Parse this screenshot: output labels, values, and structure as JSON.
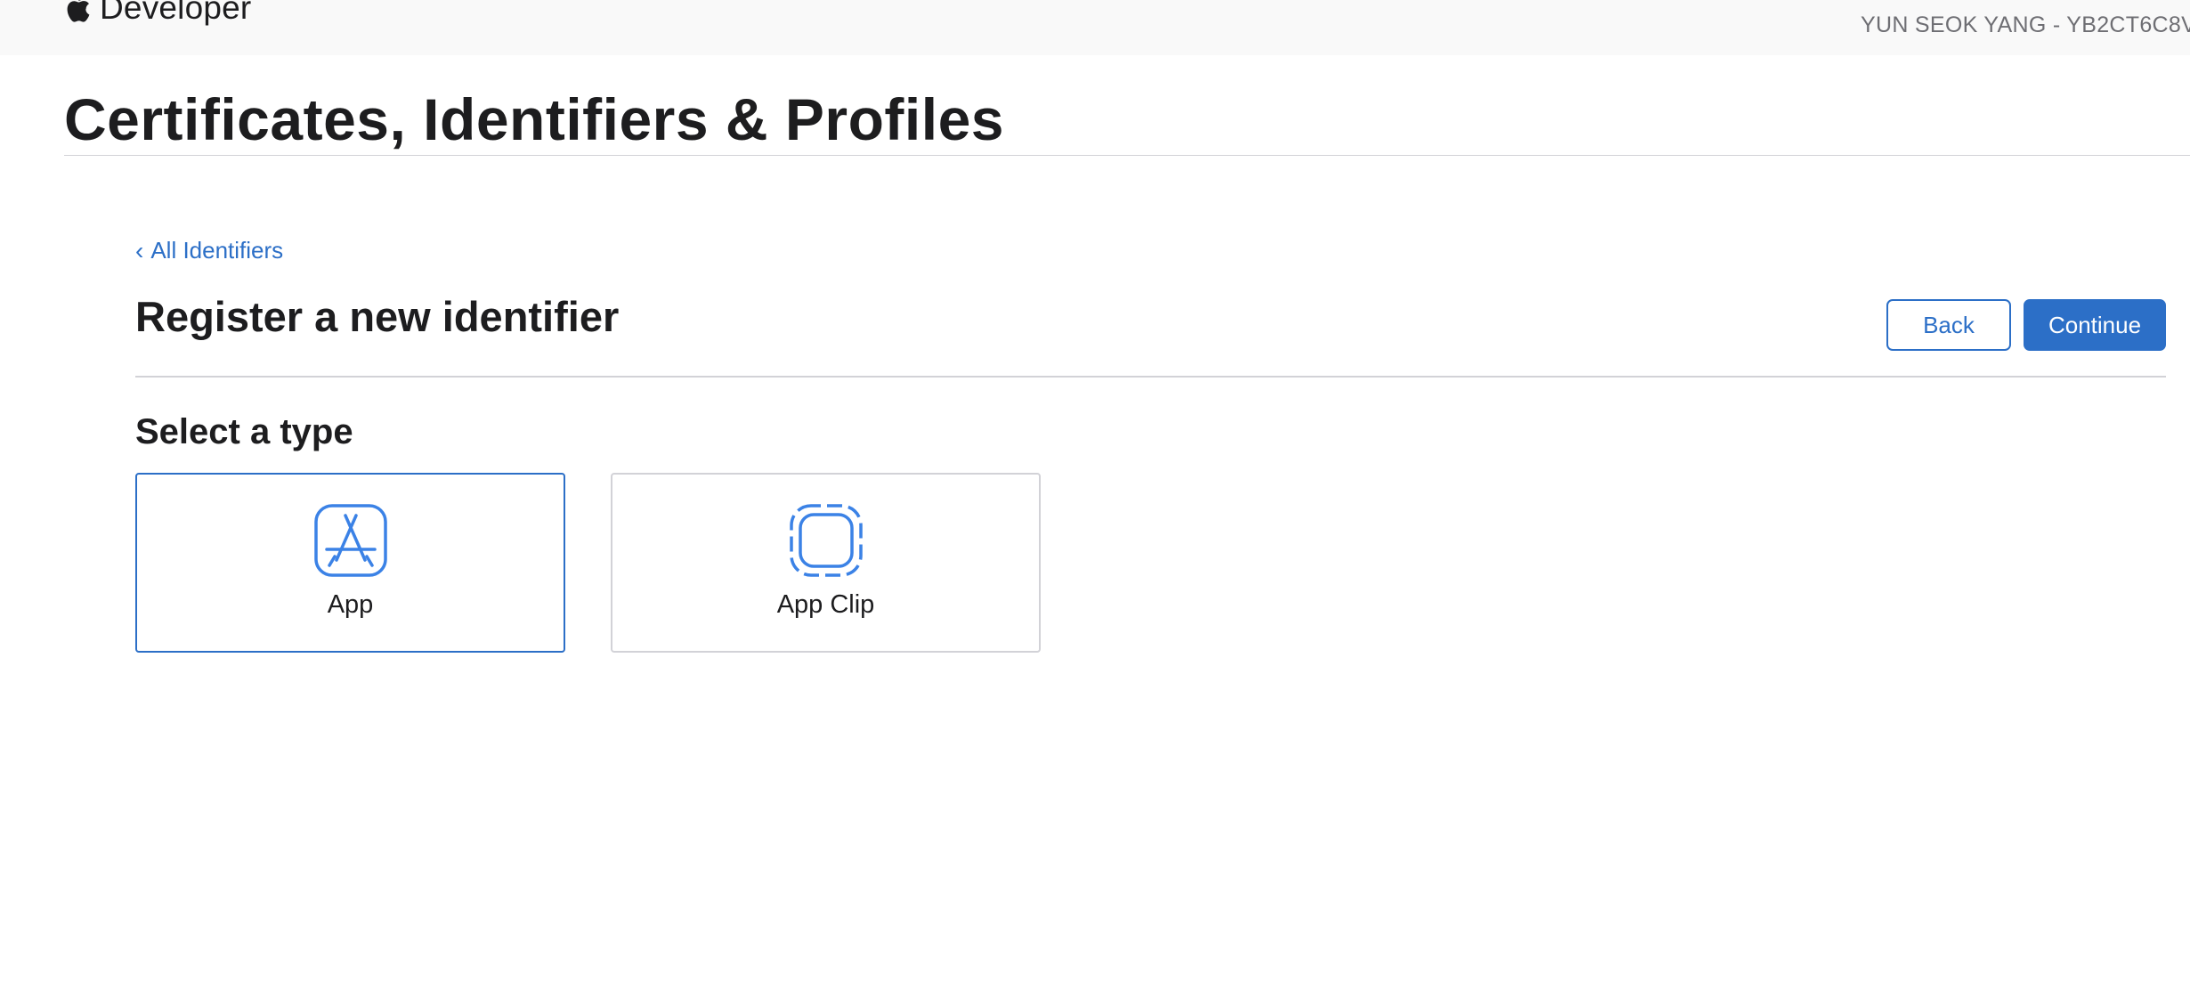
{
  "header": {
    "brand_text": "Developer",
    "brand_icon": "apple-logo-icon",
    "account": "YUN SEOK YANG - YB2CT6C8V"
  },
  "page": {
    "title": "Certificates, Identifiers & Profiles"
  },
  "nav": {
    "back_link_label": "All Identifiers",
    "back_link_chevron": "‹"
  },
  "section": {
    "title": "Register a new identifier",
    "back_button": "Back",
    "continue_button": "Continue"
  },
  "type_selector": {
    "title": "Select a type",
    "options": [
      {
        "label": "App",
        "icon": "app-store-icon",
        "selected": true
      },
      {
        "label": "App Clip",
        "icon": "app-clip-icon",
        "selected": false
      }
    ]
  },
  "colors": {
    "accent": "#2c6fc7",
    "icon_blue": "#3b82e6",
    "border_gray": "#d2d2d7",
    "header_bg": "#f9f9f9"
  }
}
